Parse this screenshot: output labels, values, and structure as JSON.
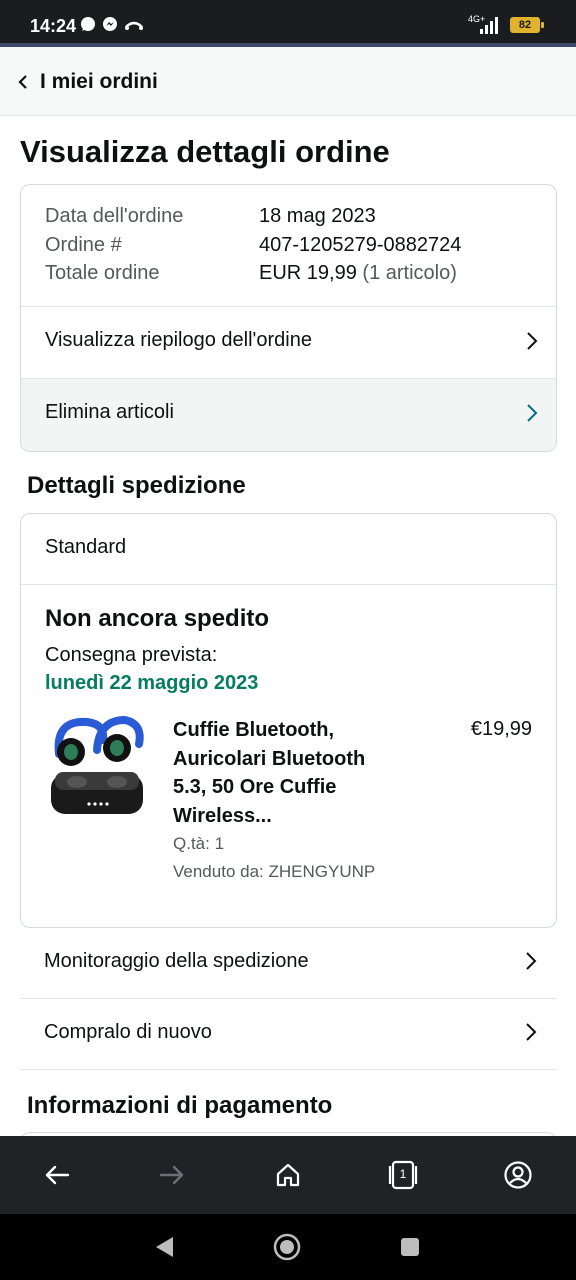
{
  "status_bar": {
    "time": "14:24",
    "network": "4G+",
    "battery": "82",
    "icons": [
      "whatsapp-icon",
      "messenger-icon",
      "missed-call-icon",
      "signal-icon",
      "battery-icon"
    ]
  },
  "top_nav": {
    "back_label": "I miei ordini",
    "back_icon": "chevron-left-icon"
  },
  "page": {
    "title": "Visualizza dettagli ordine"
  },
  "order_summary": {
    "date_label": "Data dell'ordine",
    "date_value": "18 mag 2023",
    "order_label": "Ordine #",
    "order_value": "407-1205279-0882724",
    "total_label": "Totale ordine",
    "total_value": "EUR 19,99",
    "total_items": "(1 articolo)",
    "summary_link": "Visualizza riepilogo dell'ordine",
    "delete_link": "Elimina articoli"
  },
  "shipping": {
    "section_title": "Dettagli spedizione",
    "method": "Standard",
    "status": "Non ancora spedito",
    "delivery_label": "Consegna prevista:",
    "delivery_date": "lunedì 22 maggio 2023",
    "product": {
      "title": "Cuffie Bluetooth, Auricolari Bluetooth 5.3, 50 Ore Cuffie Wireless...",
      "price": "€19,99",
      "quantity": "Q.tà: 1",
      "seller": "Venduto da: ZHENGYUNP"
    }
  },
  "actions": {
    "track": "Monitoraggio della spedizione",
    "buy_again": "Compralo di nuovo"
  },
  "payment": {
    "section_title": "Informazioni di pagamento"
  },
  "browser_bar": {
    "tab_count": "1",
    "icons": [
      "back-arrow-icon",
      "forward-arrow-icon",
      "home-icon",
      "tabs-icon",
      "account-icon"
    ]
  },
  "android_nav": {
    "icons": [
      "nav-back-icon",
      "nav-home-icon",
      "nav-recents-icon"
    ]
  },
  "colors": {
    "accent_green": "#067d62",
    "delete_chevron": "#007185",
    "status_bar_bg": "#1b1c1f",
    "browser_bar_bg": "#202226",
    "battery": "#e0b22d"
  }
}
